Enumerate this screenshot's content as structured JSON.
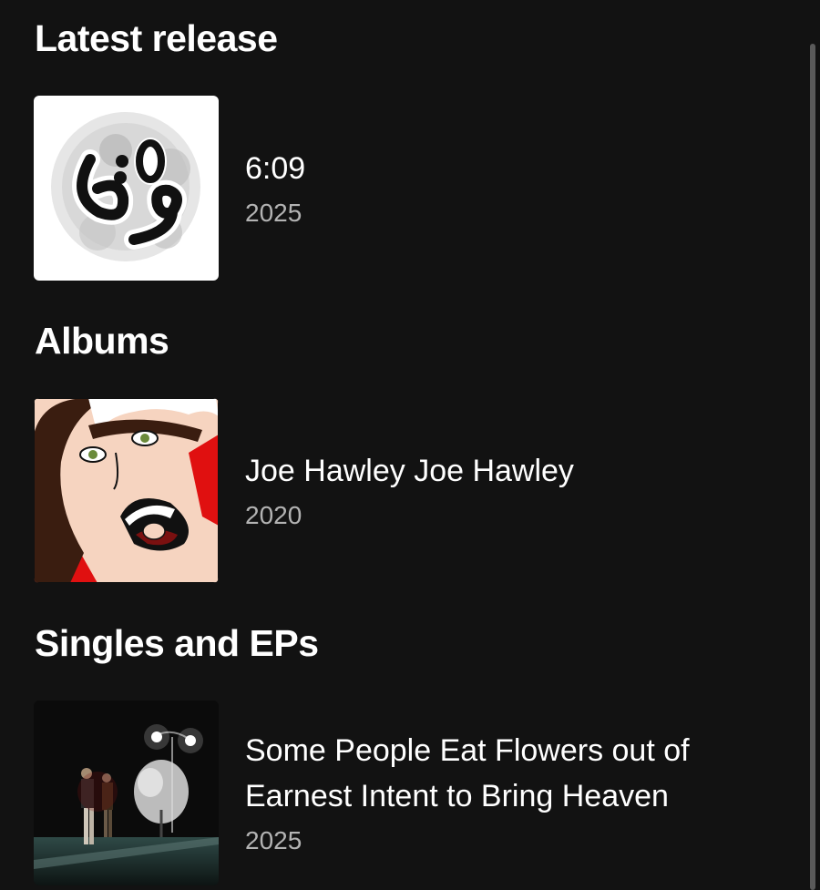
{
  "sections": {
    "latest": {
      "title": "Latest release",
      "item": {
        "title": "6:09",
        "year": "2025",
        "cover_icon": "6:09-logo-artwork"
      }
    },
    "albums": {
      "title": "Albums",
      "item": {
        "title": "Joe Hawley Joe Hawley",
        "year": "2020",
        "cover_icon": "cartoon-face-artwork"
      }
    },
    "singles": {
      "title": "Singles and EPs",
      "item": {
        "title_line1": "Some People Eat Flowers out of",
        "title_line2": "Earnest Intent to Bring Heaven",
        "year": "2025",
        "cover_icon": "night-street-artwork"
      }
    }
  },
  "colors": {
    "background": "#121212",
    "title_text": "#ffffff",
    "secondary_text": "#b3b3b3",
    "scrollbar": "#5a5a5a"
  }
}
